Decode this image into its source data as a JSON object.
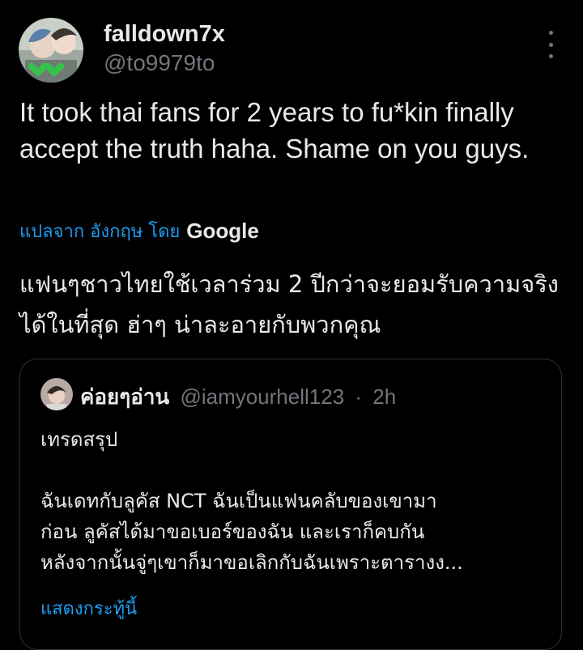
{
  "tweet": {
    "display_name": "falldown7x",
    "handle": "@to9979to",
    "text": "It took thai fans for 2 years to fu*kin finally accept the truth haha. Shame on you guys.",
    "more_icon": "more-vertical-icon",
    "translation": {
      "link_label": "แปลจาก อังกฤษ โดย",
      "provider": "Google",
      "text": "แฟนๆชาวไทยใช้เวลาร่วม 2 ปีกว่าจะยอมรับความจริงได้ในที่สุด ฮ่าๆ น่าละอายกับพวกคุณ"
    }
  },
  "quote": {
    "display_name": "ค่อยๆอ่าน",
    "handle": "@iamyourhell123",
    "separator": "·",
    "time": "2h",
    "title_line": "เทรดสรุป",
    "body_lines": [
      "ฉันเดทกับลูคัส NCT ฉันเป็นแฟนคลับของเขามา",
      "ก่อน ลูคัสได้มาขอเบอร์ของฉัน และเราก็คบกัน",
      "หลังจากนั้นจู่ๆเขาก็มาขอเลิกกับฉันเพราะตารางง..."
    ],
    "show_more_label": "แสดงกระทู้นี้"
  },
  "colors": {
    "background": "#000000",
    "text": "#e7e9ea",
    "muted": "#71767b",
    "link": "#1d9bf0",
    "border": "#2f3336"
  }
}
